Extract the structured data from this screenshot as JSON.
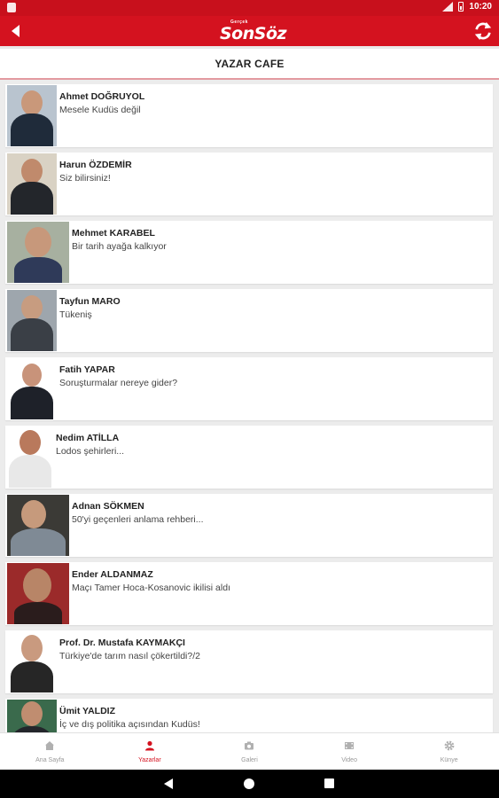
{
  "status_bar": {
    "time": "10:20"
  },
  "app_bar": {
    "logo_small": "Gerçek",
    "logo_text": "SonSöz"
  },
  "page": {
    "title": "YAZAR CAFE"
  },
  "authors": [
    {
      "name": "Ahmet DOĞRUYOL",
      "headline": "Mesele Kudüs değil"
    },
    {
      "name": "Harun ÖZDEMİR",
      "headline": "Siz bilirsiniz!"
    },
    {
      "name": "Mehmet KARABEL",
      "headline": "Bir tarih ayağa kalkıyor"
    },
    {
      "name": "Tayfun MARO",
      "headline": "Tükeniş"
    },
    {
      "name": "Fatih YAPAR",
      "headline": "Soruşturmalar nereye gider?"
    },
    {
      "name": "Nedim ATİLLA",
      "headline": "Lodos şehirleri..."
    },
    {
      "name": "Adnan SÖKMEN",
      "headline": "50'yi geçenleri anlama rehberi..."
    },
    {
      "name": "Ender ALDANMAZ",
      "headline": "Maçı Tamer Hoca-Kosanovic ikilisi aldı"
    },
    {
      "name": "Prof. Dr. Mustafa KAYMAKÇI",
      "headline": "Türkiye'de tarım nasıl çökertildi?/2"
    },
    {
      "name": "Ümit YALDIZ",
      "headline": "İç ve dış politika açısından Kudüs!"
    }
  ],
  "bottom_nav": [
    {
      "label": "Ana Sayfa",
      "icon": "home-icon"
    },
    {
      "label": "Yazarlar",
      "icon": "person-icon",
      "active": true
    },
    {
      "label": "Galeri",
      "icon": "camera-icon"
    },
    {
      "label": "Video",
      "icon": "video-icon"
    },
    {
      "label": "Künye",
      "icon": "gear-icon"
    }
  ],
  "colors": {
    "brand_red": "#d4121f",
    "statusbar_red": "#c8101c",
    "background": "#ececec"
  }
}
